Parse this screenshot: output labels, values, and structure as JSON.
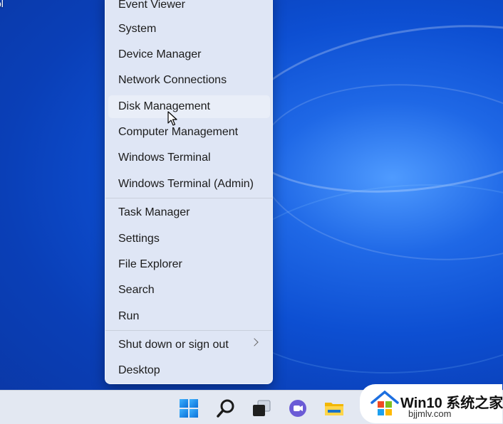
{
  "desktop": {
    "corner_label": "ol"
  },
  "menu": {
    "items": [
      {
        "label": "Event Viewer"
      },
      {
        "label": "System"
      },
      {
        "label": "Device Manager"
      },
      {
        "label": "Network Connections"
      },
      {
        "label": "Disk Management",
        "hovered": true
      },
      {
        "label": "Computer Management"
      },
      {
        "label": "Windows Terminal"
      },
      {
        "label": "Windows Terminal (Admin)"
      },
      {
        "label": "Task Manager"
      },
      {
        "label": "Settings"
      },
      {
        "label": "File Explorer"
      },
      {
        "label": "Search"
      },
      {
        "label": "Run"
      },
      {
        "label": "Shut down or sign out",
        "has_submenu": true
      },
      {
        "label": "Desktop"
      }
    ]
  },
  "taskbar": {
    "icons": [
      "windows-start-icon",
      "search-icon",
      "task-view-icon",
      "chat-icon",
      "file-explorer-icon"
    ]
  },
  "watermark": {
    "title": "Win10 系统之家",
    "url": "bjjmlv.com"
  },
  "colors": {
    "desktop_blue": "#0d4fd2",
    "menu_bg": "#dfe6f5",
    "taskbar_bg": "#e3e8f2"
  }
}
